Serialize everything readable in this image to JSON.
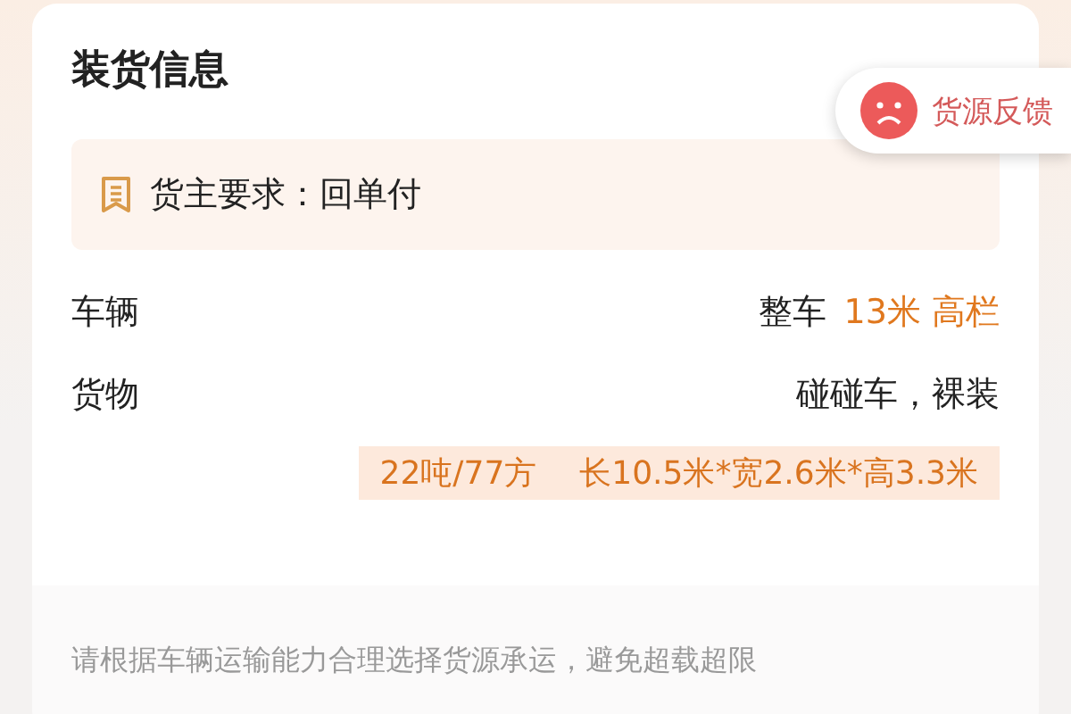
{
  "card": {
    "title": "装货信息"
  },
  "feedback": {
    "label": "货源反馈"
  },
  "notice": {
    "text": "货主要求：回单付"
  },
  "rows": [
    {
      "label": "车辆",
      "values": [
        {
          "text": "整车",
          "highlight": false
        },
        {
          "text": "13米 高栏",
          "highlight": true
        }
      ]
    },
    {
      "label": "货物",
      "values": [
        {
          "text": "碰碰车，裸装",
          "highlight": false
        }
      ]
    }
  ],
  "tags": [
    "22吨/77方",
    "长10.5米*宽2.6米*高3.3米"
  ],
  "footer": {
    "text": "请根据车辆运输能力合理选择货源承运，避免超载超限"
  }
}
